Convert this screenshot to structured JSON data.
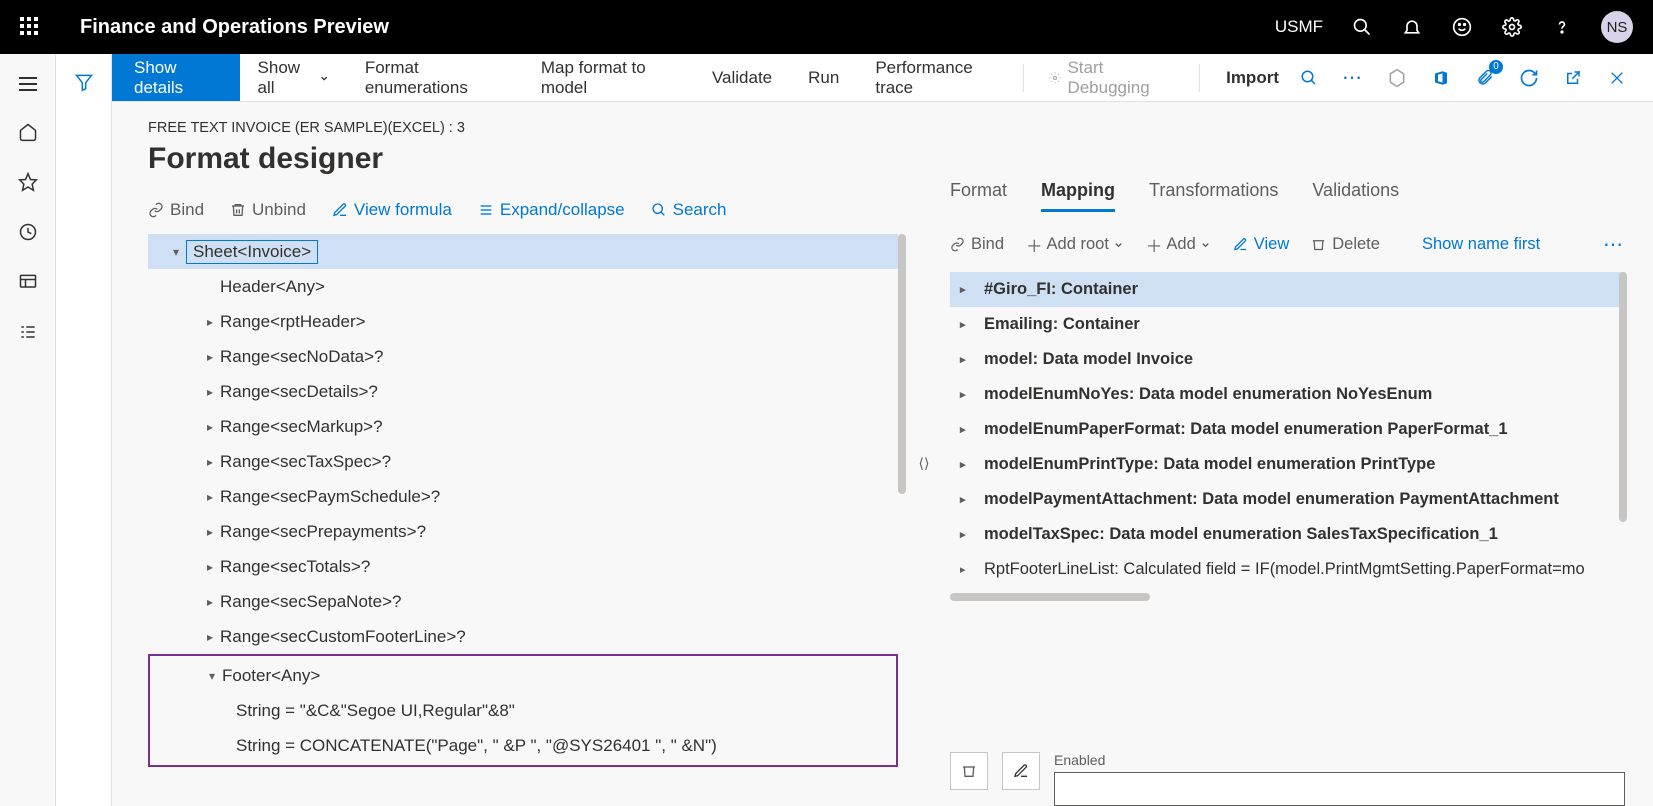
{
  "header": {
    "app_title": "Finance and Operations Preview",
    "company": "USMF",
    "user_initials": "NS"
  },
  "commandbar": {
    "show_details": "Show details",
    "show_all": "Show all",
    "format_enum": "Format enumerations",
    "map_format": "Map format to model",
    "validate": "Validate",
    "run": "Run",
    "perf_trace": "Performance trace",
    "start_debug": "Start Debugging",
    "import": "Import",
    "attachments_badge": "0"
  },
  "page": {
    "breadcrumb": "FREE TEXT INVOICE (ER SAMPLE)(EXCEL) : 3",
    "title": "Format designer"
  },
  "subtoolbar": {
    "bind": "Bind",
    "unbind": "Unbind",
    "view_formula": "View formula",
    "expand": "Expand/collapse",
    "search": "Search"
  },
  "tree": {
    "root": "Sheet<Invoice>",
    "items": [
      "Header<Any>",
      "Range<rptHeader>",
      "Range<secNoData>?",
      "Range<secDetails>?",
      "Range<secMarkup>?",
      "Range<secTaxSpec>?",
      "Range<secPaymSchedule>?",
      "Range<secPrepayments>?",
      "Range<secTotals>?",
      "Range<secSepaNote>?",
      "Range<secCustomFooterLine>?"
    ],
    "footer": {
      "label": "Footer<Any>",
      "child1": "String = \"&C&\"Segoe UI,Regular\"&8\"",
      "child2": "String = CONCATENATE(\"Page\", \" &P \", \"@SYS26401 \", \" &N\")"
    }
  },
  "tabs": {
    "format": "Format",
    "mapping": "Mapping",
    "transformations": "Transformations",
    "validations": "Validations"
  },
  "map_toolbar": {
    "bind": "Bind",
    "add_root": "Add root",
    "add": "Add",
    "view": "View",
    "delete": "Delete",
    "show_name": "Show name first"
  },
  "map_tree": [
    "#Giro_FI: Container",
    "Emailing: Container",
    "model: Data model Invoice",
    "modelEnumNoYes: Data model enumeration NoYesEnum",
    "modelEnumPaperFormat: Data model enumeration PaperFormat_1",
    "modelEnumPrintType: Data model enumeration PrintType",
    "modelPaymentAttachment: Data model enumeration PaymentAttachment",
    "modelTaxSpec: Data model enumeration SalesTaxSpecification_1",
    "RptFooterLineList: Calculated field = IF(model.PrintMgmtSetting.PaperFormat=mo"
  ],
  "enabled": {
    "label": "Enabled"
  }
}
